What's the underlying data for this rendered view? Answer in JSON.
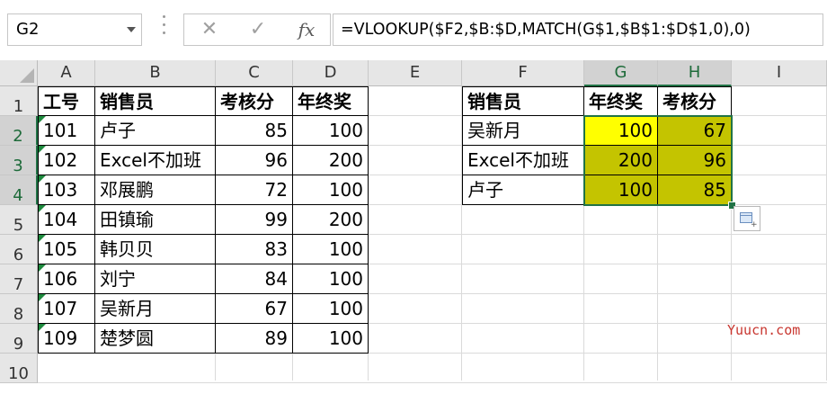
{
  "name_box": "G2",
  "formula_buttons": {
    "cancel": "✕",
    "enter": "✓",
    "fx": "fx"
  },
  "formula": "=VLOOKUP($F2,$B:$D,MATCH(G$1,$B$1:$D$1,0),0)",
  "columns": [
    "A",
    "B",
    "C",
    "D",
    "E",
    "F",
    "G",
    "H",
    "I"
  ],
  "rows": [
    "1",
    "2",
    "3",
    "4",
    "5",
    "6",
    "7",
    "8",
    "9",
    "10"
  ],
  "table1": {
    "headers": [
      "工号",
      "销售员",
      "考核分",
      "年终奖"
    ],
    "rows": [
      [
        "101",
        "卢子",
        "85",
        "100"
      ],
      [
        "102",
        "Excel不加班",
        "96",
        "200"
      ],
      [
        "103",
        "邓展鹏",
        "72",
        "100"
      ],
      [
        "104",
        "田镇瑜",
        "99",
        "200"
      ],
      [
        "105",
        "韩贝贝",
        "83",
        "100"
      ],
      [
        "106",
        "刘宁",
        "84",
        "100"
      ],
      [
        "107",
        "吴新月",
        "67",
        "100"
      ],
      [
        "109",
        "楚梦圆",
        "89",
        "100"
      ]
    ]
  },
  "table2": {
    "headers": [
      "销售员",
      "年终奖",
      "考核分"
    ],
    "rows": [
      [
        "吴新月",
        "100",
        "67"
      ],
      [
        "Excel不加班",
        "200",
        "96"
      ],
      [
        "卢子",
        "100",
        "85"
      ]
    ]
  },
  "colors": {
    "active_cell": "#ffff00",
    "selection_fill": "#c4c400",
    "selection_border": "#217346",
    "error_indicator": "#1e8a3e"
  },
  "watermark": "Yuucn.com"
}
